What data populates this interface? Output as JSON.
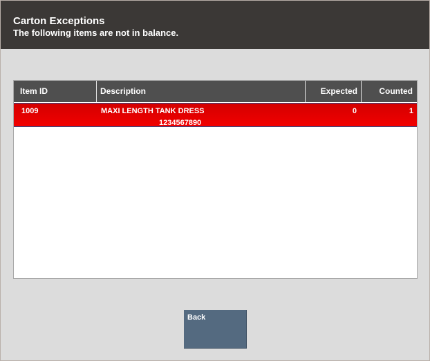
{
  "header": {
    "title": "Carton Exceptions",
    "subtitle": "The following items are not in balance."
  },
  "table": {
    "columns": {
      "item_id": "Item ID",
      "description": "Description",
      "expected": "Expected",
      "counted": "Counted"
    },
    "rows": [
      {
        "item_id": "1009",
        "description": "MAXI LENGTH TANK DRESS",
        "upc": "1234567890",
        "expected": "0",
        "counted": "1",
        "selected": true
      }
    ]
  },
  "buttons": {
    "back_label": "Back"
  },
  "colors": {
    "header_bg": "#3b3836",
    "table_header_bg": "#4f4f4f",
    "selected_row_bg": "#e40000",
    "button_bg": "#546a80"
  }
}
